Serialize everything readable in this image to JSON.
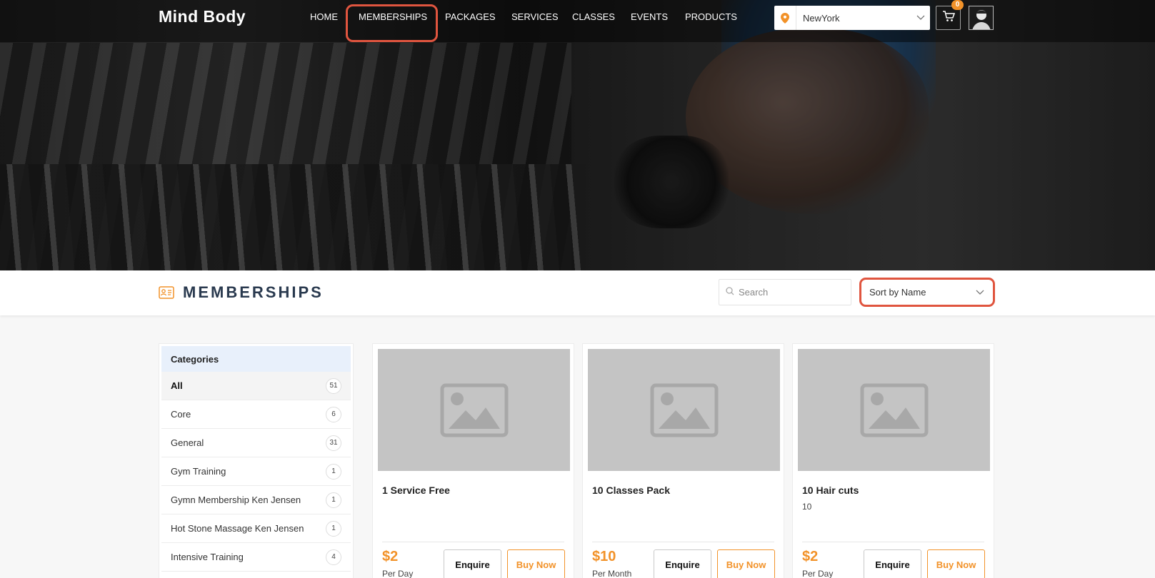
{
  "brand": {
    "logo": "Mind Body",
    "accent": "#f29229",
    "highlight": "#e0553f"
  },
  "nav": {
    "items": [
      "HOME",
      "MEMBERSHIPS",
      "PACKAGES",
      "SERVICES",
      "CLASSES",
      "EVENTS",
      "PRODUCTS"
    ],
    "active": "MEMBERSHIPS"
  },
  "location": {
    "value": "NewYork",
    "icon": "map-pin-icon"
  },
  "cart": {
    "count": "0",
    "icon": "cart-icon"
  },
  "page": {
    "title": "MEMBERSHIPS",
    "title_icon": "id-card-icon",
    "search_placeholder": "Search",
    "sort_value": "Sort by Name"
  },
  "categories": {
    "header": "Categories",
    "items": [
      {
        "label": "All",
        "count": "51",
        "active": true
      },
      {
        "label": "Core",
        "count": "6"
      },
      {
        "label": "General",
        "count": "31"
      },
      {
        "label": "Gym Training",
        "count": "1"
      },
      {
        "label": "Gymn Membership Ken Jensen",
        "count": "1"
      },
      {
        "label": "Hot Stone Massage Ken Jensen",
        "count": "1"
      },
      {
        "label": "Intensive Training",
        "count": "4"
      }
    ]
  },
  "cards": [
    {
      "title": "1 Service Free",
      "subtitle": "",
      "price": "$2",
      "period": "Per Day",
      "enquire": "Enquire",
      "buy": "Buy Now"
    },
    {
      "title": "10 Classes Pack",
      "subtitle": "",
      "price": "$10",
      "period": "Per Month",
      "enquire": "Enquire",
      "buy": "Buy Now"
    },
    {
      "title": "10 Hair cuts",
      "subtitle": "10",
      "price": "$2",
      "period": "Per Day",
      "enquire": "Enquire",
      "buy": "Buy Now"
    }
  ]
}
